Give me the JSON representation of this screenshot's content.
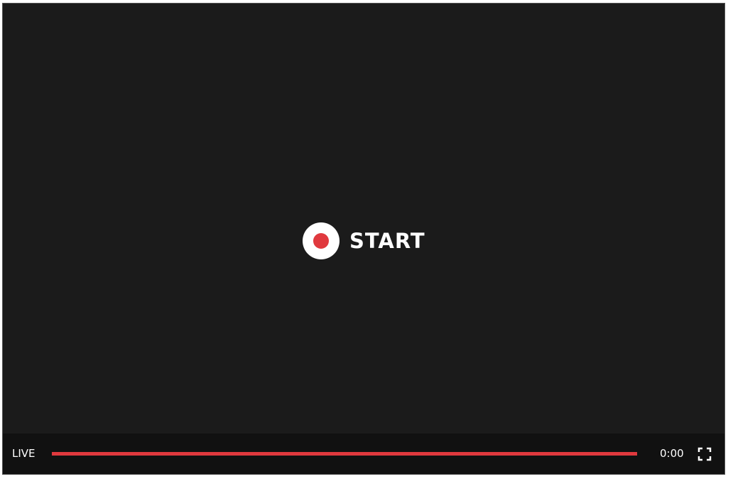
{
  "player": {
    "start_label": "START",
    "live_label": "LIVE",
    "time": "0:00",
    "progress": 1.0,
    "accent_color": "#e0393e",
    "icons": {
      "record": "record-icon",
      "fullscreen": "fullscreen-icon"
    }
  }
}
